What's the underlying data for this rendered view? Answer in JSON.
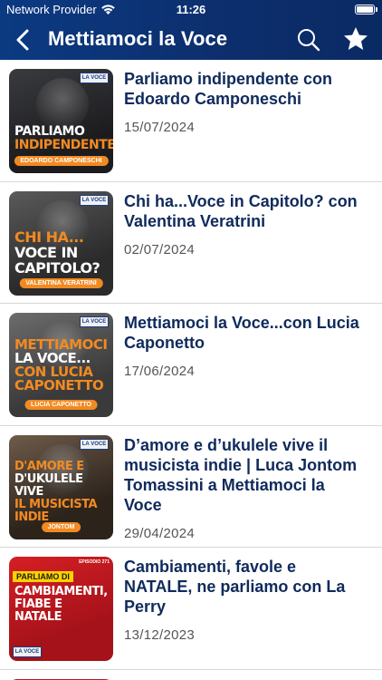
{
  "status_bar": {
    "carrier": "Network Provider",
    "time": "11:26"
  },
  "nav": {
    "title": "Mettiamoci la Voce",
    "icons": [
      "chevron-left-icon",
      "search-icon",
      "star-icon"
    ]
  },
  "episodes": [
    {
      "title": "Parliamo indipendente con Edoardo Camponeschi",
      "date": "15/07/2024",
      "thumb": {
        "line1": "PARLIAMO",
        "line2": "INDIPENDENTE",
        "pill": "EDOARDO CAMPONESCHI"
      }
    },
    {
      "title": "Chi ha...Voce in Capitolo? con Valentina Veratrini",
      "date": "02/07/2024",
      "thumb": {
        "line1": "CHI HA...",
        "line2": "VOCE IN",
        "line3": "CAPITOLO?",
        "pill": "VALENTINA VERATRINI"
      }
    },
    {
      "title": "Mettiamoci la Voce...con Lucia Caponetto",
      "date": "17/06/2024",
      "thumb": {
        "line1": "METTIAMOCI",
        "line2": "LA VOCE...",
        "line3": "CON LUCIA",
        "line4": "CAPONETTO",
        "pill": "LUCIA CAPONETTO"
      }
    },
    {
      "title": "D’amore e d’ukulele vive il musicista indie | Luca Jontom Tomassini a Mettiamoci la Voce",
      "date": "29/04/2024",
      "thumb": {
        "line1": "D'AMORE E",
        "line2": "D'UKULELE VIVE",
        "line3": "IL MUSICISTA",
        "line4": "INDIE",
        "pill": "JONTOM"
      }
    },
    {
      "title": "Cambiamenti, favole e NATALE, ne parliamo con La Perry",
      "date": "13/12/2023",
      "thumb": {
        "tag": "PARLIAMO DI",
        "line1": "CAMBIAMENTI,",
        "line2": "FIABE E",
        "line3": "NATALE",
        "episode": "EPISODIO 271"
      }
    }
  ],
  "logo_text": "LA VOCE",
  "colors": {
    "header": "#0b3a82",
    "title_text": "#0f2a5c",
    "accent_orange": "#f28a22"
  }
}
